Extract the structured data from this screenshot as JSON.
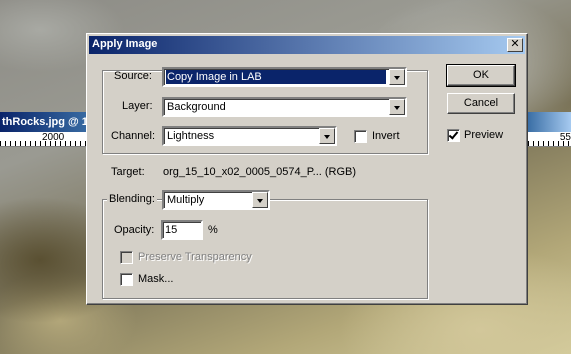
{
  "background_window": {
    "title": "thRocks.jpg @ 1",
    "ruler_label": "2000",
    "ruler_right_label": "55"
  },
  "dialog": {
    "title": "Apply Image",
    "close_glyph": "✕",
    "source": {
      "label": "Source:",
      "value": "Copy Image in LAB"
    },
    "layer": {
      "label": "Layer:",
      "value": "Background"
    },
    "channel": {
      "label": "Channel:",
      "value": "Lightness"
    },
    "invert": {
      "label": "Invert",
      "checked": false
    },
    "target": {
      "label": "Target:",
      "value": "org_15_10_x02_0005_0574_P... (RGB)"
    },
    "blending": {
      "label": "Blending:",
      "value": "Multiply"
    },
    "opacity": {
      "label": "Opacity:",
      "value": "15",
      "unit": "%"
    },
    "preserve_transparency": {
      "label": "Preserve Transparency",
      "checked": false,
      "enabled": false
    },
    "mask": {
      "label": "Mask...",
      "checked": false
    },
    "ok_label": "OK",
    "cancel_label": "Cancel",
    "preview": {
      "label": "Preview",
      "checked": true
    }
  },
  "colors": {
    "titlebar_start": "#0a246a",
    "titlebar_end": "#a6caf0",
    "dialog_face": "#d4d0c8",
    "selection": "#0a246a"
  }
}
